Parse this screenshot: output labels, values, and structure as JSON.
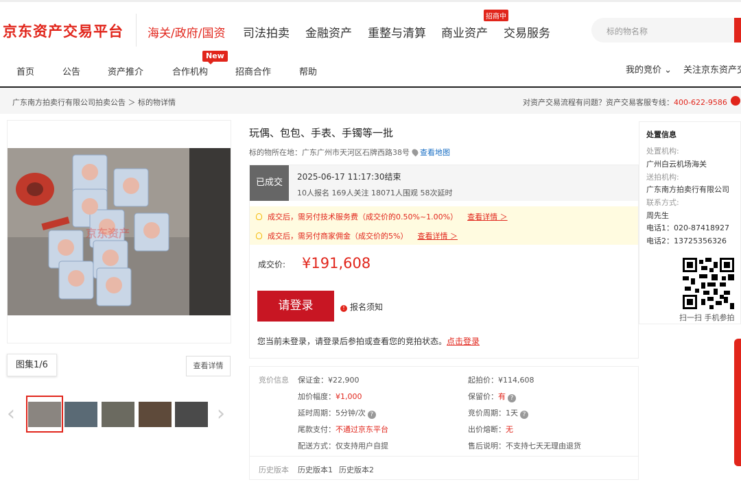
{
  "header": {
    "logo": "京东资产交易平台",
    "nav": [
      "海关/政府/国资",
      "司法拍卖",
      "金融资产",
      "重整与清算",
      "商业资产",
      "交易服务"
    ],
    "nav_badge": "招商中",
    "search_placeholder": "标的物名称"
  },
  "subnav": {
    "items": [
      "首页",
      "公告",
      "资产推介",
      "合作机构",
      "招商合作",
      "帮助"
    ],
    "new_badge": "New",
    "right_items": [
      "我的竞价 ⌄",
      "关注京东资产交"
    ]
  },
  "breadcrumb": {
    "text": "广东南方拍卖行有限公司拍卖公告 ＞ 标的物详情",
    "help_prefix": "对资产交易流程有问题？资产交易客服专线：",
    "hotline": "400-622-9586"
  },
  "gallery": {
    "tab": "图集1/6",
    "detail_button": "查看详情",
    "prev": "‹",
    "next": "›",
    "watermark": "京东资产"
  },
  "item": {
    "title": "玩偶、包包、手表、手镯等一批",
    "location_label": "标的物所在地：",
    "location": "广东广州市天河区石牌西路38号",
    "map_link": "查看地图",
    "status": "已成交",
    "end_time": "2025-06-17 11:17:30结束",
    "stats": "10人报名 169人关注 18071人围观 58次延时",
    "notice_1": "成交后，需另付技术服务费（成交价的0.50%~1.00%）",
    "notice_1_link": "查看详情 ＞",
    "notice_2": "成交后，需另付商家佣金（成交价的5%）",
    "notice_2_link": "查看详情 ＞",
    "price_label": "成交价:",
    "price": "¥191,608",
    "login_button": "请登录",
    "register_notice": "报名须知",
    "login_tip": "您当前未登录，请登录后参拍或查看您的竞拍状态。",
    "login_link": "点击登录"
  },
  "bid_info": {
    "section_label": "竞价信息",
    "deposit_label": "保证金：",
    "deposit": "¥22,900",
    "start_label": "起拍价：",
    "start": "¥114,608",
    "increment_label": "加价幅度：",
    "increment": "¥1,000",
    "reserve_label": "保留价：",
    "reserve": "有",
    "delay_label": "延时周期：",
    "delay": "5分钟/次",
    "period_label": "竞价周期：",
    "period": "1天",
    "final_label": "尾款支付：",
    "final": "不通过京东平台",
    "fuse_label": "出价熔断：",
    "fuse": "无",
    "delivery_label": "配送方式：",
    "delivery": "仅支持用户自提",
    "aftersale_label": "售后说明：",
    "aftersale": "不支持七天无理由退货",
    "history_label": "历史版本",
    "history_1": "历史版本1",
    "history_2": "历史版本2"
  },
  "disposal": {
    "title": "处置信息",
    "org_label": "处置机构:",
    "org": "广州白云机场海关",
    "agent_label": "送拍机构:",
    "agent": "广东南方拍卖行有限公司",
    "contact_label": "联系方式:",
    "contact": "周先生",
    "phone1": "电话1：020-87418927",
    "phone2": "电话2：13725356326",
    "qr_caption": "扫一扫 手机参拍"
  },
  "colors": {
    "brand": "#e1251b",
    "login_button": "#c81623",
    "notice_bg": "#fffbe0"
  }
}
